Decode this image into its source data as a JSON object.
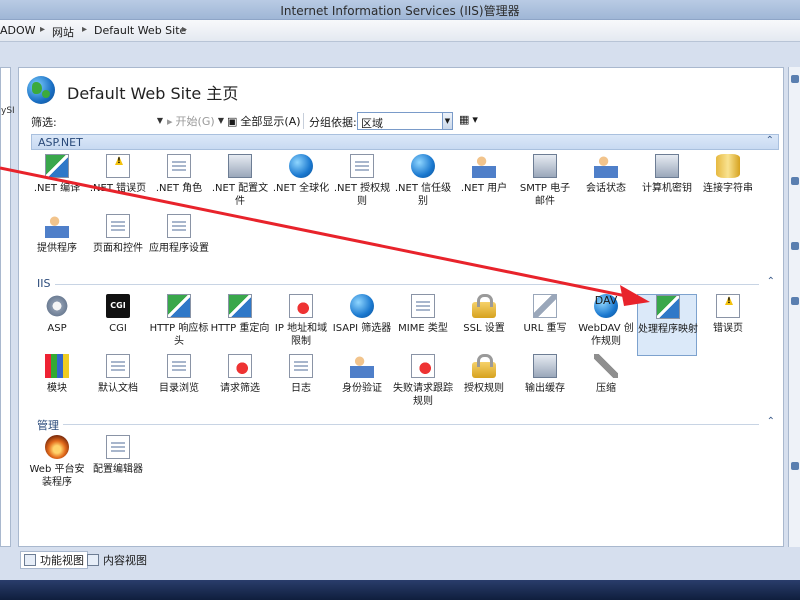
{
  "window": {
    "title": "Internet Information Services (IIS)管理器"
  },
  "address": {
    "crumbs": [
      "ADOW",
      "网站",
      "Default Web Site"
    ]
  },
  "left_fragment": "ySI",
  "page": {
    "title": "Default Web Site 主页"
  },
  "filter": {
    "label": "筛选:",
    "start_label": "开始(G)",
    "show_all_label": "全部显示(A)",
    "group_label": "分组依据:",
    "group_value": "区域"
  },
  "groups": [
    {
      "name": "ASP.NET",
      "items": [
        {
          "label": ".NET 编译",
          "icon": "download-doc-icon"
        },
        {
          "label": ".NET 错误页",
          "icon": "error-page-icon"
        },
        {
          "label": ".NET 角色",
          "icon": "roles-icon"
        },
        {
          "label": ".NET 配置文件",
          "icon": "profile-icon"
        },
        {
          "label": ".NET 全球化",
          "icon": "globe-icon"
        },
        {
          "label": ".NET 授权规则",
          "icon": "auth-rules-icon"
        },
        {
          "label": ".NET 信任级别",
          "icon": "trust-level-icon"
        },
        {
          "label": ".NET 用户",
          "icon": "users-icon"
        },
        {
          "label": "SMTP 电子邮件",
          "icon": "email-icon"
        },
        {
          "label": "会话状态",
          "icon": "session-icon"
        },
        {
          "label": "计算机密钥",
          "icon": "machine-key-icon"
        },
        {
          "label": "连接字符串",
          "icon": "connection-string-icon"
        },
        {
          "label": "提供程序",
          "icon": "providers-icon"
        },
        {
          "label": "页面和控件",
          "icon": "pages-controls-icon"
        },
        {
          "label": "应用程序设置",
          "icon": "app-settings-icon"
        }
      ]
    },
    {
      "name": "IIS",
      "items": [
        {
          "label": "ASP",
          "icon": "asp-icon"
        },
        {
          "label": "CGI",
          "icon": "cgi-icon",
          "text": "CGI"
        },
        {
          "label": "HTTP 响应标头",
          "icon": "http-headers-icon"
        },
        {
          "label": "HTTP 重定向",
          "icon": "redirect-icon"
        },
        {
          "label": "IP 地址和域限制",
          "icon": "ip-restrict-icon"
        },
        {
          "label": "ISAPI 筛选器",
          "icon": "isapi-icon"
        },
        {
          "label": "MIME 类型",
          "icon": "mime-icon"
        },
        {
          "label": "SSL 设置",
          "icon": "lock-icon"
        },
        {
          "label": "URL 重写",
          "icon": "url-rewrite-icon"
        },
        {
          "label": "WebDAV 创作规则",
          "icon": "webdav-icon",
          "text": "DAV"
        },
        {
          "label": "处理程序映射",
          "icon": "handler-mappings-icon",
          "selected": true
        },
        {
          "label": "错误页",
          "icon": "error-pages-icon"
        },
        {
          "label": "模块",
          "icon": "modules-icon"
        },
        {
          "label": "默认文档",
          "icon": "default-doc-icon"
        },
        {
          "label": "目录浏览",
          "icon": "dir-browse-icon"
        },
        {
          "label": "请求筛选",
          "icon": "request-filter-icon"
        },
        {
          "label": "日志",
          "icon": "logging-icon"
        },
        {
          "label": "身份验证",
          "icon": "authentication-icon"
        },
        {
          "label": "失败请求跟踪规则",
          "icon": "failed-request-icon"
        },
        {
          "label": "授权规则",
          "icon": "authorization-icon"
        },
        {
          "label": "输出缓存",
          "icon": "output-cache-icon"
        },
        {
          "label": "压缩",
          "icon": "compression-icon"
        }
      ]
    },
    {
      "name": "管理",
      "items": [
        {
          "label": "Web 平台安装程序",
          "icon": "web-platform-icon"
        },
        {
          "label": "配置编辑器",
          "icon": "config-editor-icon"
        }
      ]
    }
  ],
  "bottom_tabs": [
    {
      "label": "功能视图",
      "active": true
    },
    {
      "label": "内容视图",
      "active": false
    }
  ],
  "colors": {
    "annotation_arrow": "#e8232b",
    "group_header": "#2a4a7a",
    "selected_tile": "#dbe9f9"
  }
}
